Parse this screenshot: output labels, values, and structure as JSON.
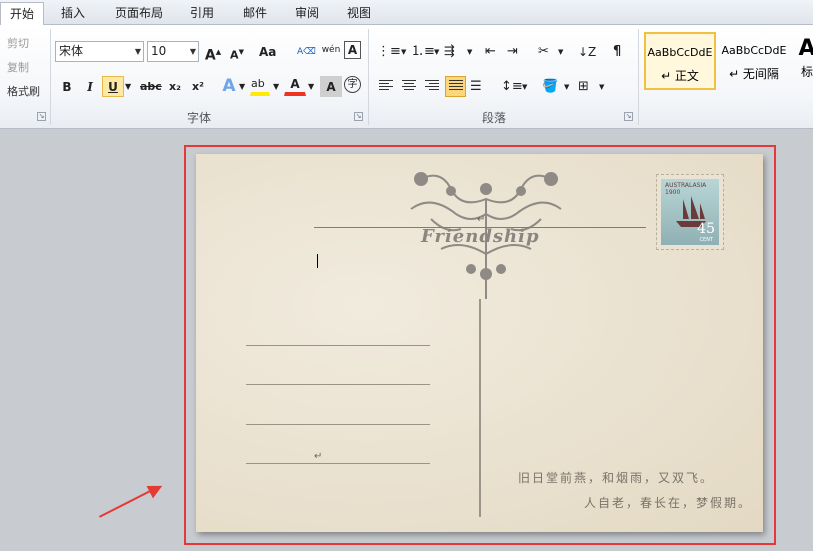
{
  "tabs": [
    {
      "label": "开始",
      "active": true
    },
    {
      "label": "插入"
    },
    {
      "label": "页面布局"
    },
    {
      "label": "引用"
    },
    {
      "label": "邮件"
    },
    {
      "label": "审阅"
    },
    {
      "label": "视图"
    }
  ],
  "clipboard": {
    "cut": "剪切",
    "copy": "复制",
    "format_painter": "格式刷"
  },
  "font": {
    "name": "宋体",
    "size": "10",
    "grow": "A",
    "shrink": "A",
    "change_case": "Aa",
    "pinyin": "wén",
    "char_border": "A",
    "bold": "B",
    "italic": "I",
    "underline": "U",
    "strike": "abc",
    "subscript": "x₂",
    "superscript": "x²",
    "text_effect": "A",
    "highlight": "ab",
    "font_color": "A",
    "char_shading": "A",
    "enclose": "字",
    "group_label": "字体"
  },
  "paragraph": {
    "group_label": "段落"
  },
  "styles": {
    "items": [
      {
        "preview": "AaBbCcDdE",
        "name": "↵ 正文",
        "selected": true
      },
      {
        "preview": "AaBbCcDdE",
        "name": "↵ 无间隔"
      },
      {
        "preview": "A",
        "name": "标"
      }
    ]
  },
  "document": {
    "friendship_text": "Friendship",
    "stamp": {
      "country": "AUSTRALASIA 1900",
      "value": "45",
      "unit": "CENT"
    },
    "poem_line1": "旧日堂前燕，和烟雨，又双飞。",
    "poem_line2": "人自老，春长在，梦假期。",
    "para_mark": "↵"
  },
  "colors": {
    "highlight_border": "#e53935",
    "accent_yellow": "#f0c040"
  }
}
